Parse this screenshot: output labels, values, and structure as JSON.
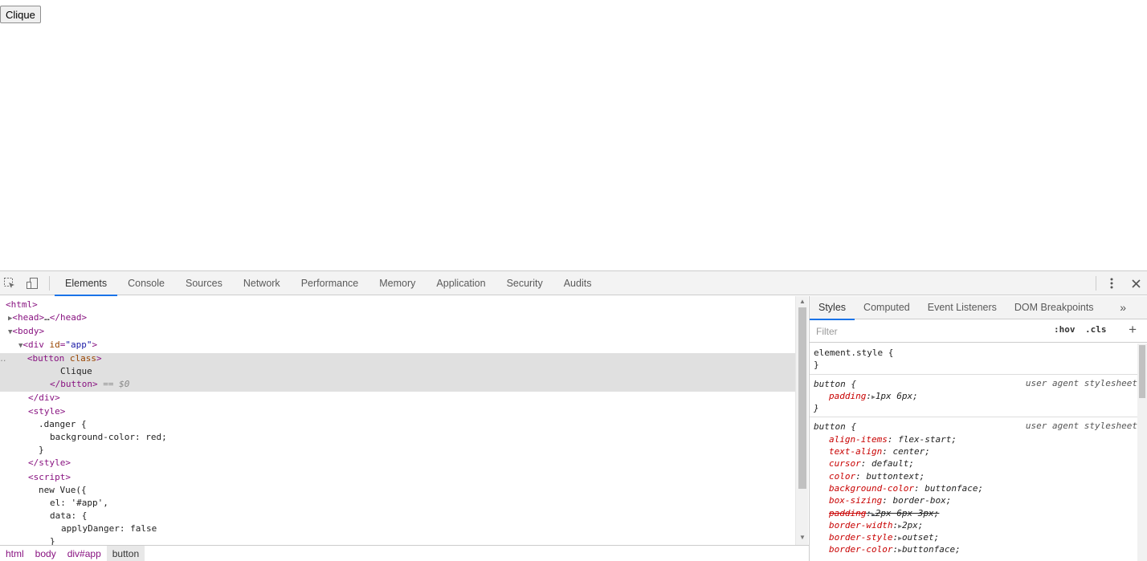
{
  "page": {
    "button_label": "Clique"
  },
  "devtools": {
    "tabs": [
      "Elements",
      "Console",
      "Sources",
      "Network",
      "Performance",
      "Memory",
      "Application",
      "Security",
      "Audits"
    ],
    "active_tab": "Elements",
    "icons": {
      "inspect": "inspect-element-icon",
      "device": "device-toolbar-icon",
      "menu": "more-vertical-icon",
      "close": "close-icon"
    },
    "dom": {
      "html_open": "<html>",
      "head_open": "<head>",
      "head_ellipsis": "…",
      "head_close": "</head>",
      "body_open": "<body>",
      "div_tag": "div",
      "div_attr": "id",
      "div_attr_val": "\"app\"",
      "button_tag": "button",
      "button_attr": "class",
      "button_text": "Clique",
      "button_close": "</button>",
      "selected_marker": "== $0",
      "div_close": "</div>",
      "style_open": "<style>",
      "css_selector": ".danger {",
      "css_decl": "background-color: red;",
      "css_close": "}",
      "style_close": "</style>",
      "script_open": "<script>",
      "js_line1": "new Vue({",
      "js_line2": "el: '#app',",
      "js_line3": "data: {",
      "js_line4": "applyDanger: false",
      "js_line5": "}"
    },
    "breadcrumbs": [
      "html",
      "body",
      "div#app",
      "button"
    ],
    "sidebar": {
      "tabs": [
        "Styles",
        "Computed",
        "Event Listeners",
        "DOM Breakpoints"
      ],
      "active_tab": "Styles",
      "more_label": "»",
      "filter_placeholder": "Filter",
      "hov_label": ":hov",
      "cls_label": ".cls",
      "add_label": "+",
      "rules": [
        {
          "selector": "element.style {",
          "origin": "",
          "close": "}",
          "properties": []
        },
        {
          "selector": "button {",
          "origin": "user agent stylesheet",
          "close": "}",
          "properties": [
            {
              "name": "padding",
              "value": "1px 6px;",
              "expandable": true,
              "overridden": false
            }
          ]
        },
        {
          "selector": "button {",
          "origin": "user agent stylesheet",
          "close": "",
          "properties": [
            {
              "name": "align-items",
              "value": "flex-start;",
              "expandable": false,
              "overridden": false
            },
            {
              "name": "text-align",
              "value": "center;",
              "expandable": false,
              "overridden": false
            },
            {
              "name": "cursor",
              "value": "default;",
              "expandable": false,
              "overridden": false
            },
            {
              "name": "color",
              "value": "buttontext;",
              "expandable": false,
              "overridden": false
            },
            {
              "name": "background-color",
              "value": "buttonface;",
              "expandable": false,
              "overridden": false
            },
            {
              "name": "box-sizing",
              "value": "border-box;",
              "expandable": false,
              "overridden": false
            },
            {
              "name": "padding",
              "value": "2px 6px 3px;",
              "expandable": true,
              "overridden": true
            },
            {
              "name": "border-width",
              "value": "2px;",
              "expandable": true,
              "overridden": false
            },
            {
              "name": "border-style",
              "value": "outset;",
              "expandable": true,
              "overridden": false
            },
            {
              "name": "border-color",
              "value": "buttonface;",
              "expandable": true,
              "overridden": false
            }
          ]
        }
      ]
    }
  },
  "colors": {
    "tag": "#881280",
    "attr_name": "#994500",
    "attr_value": "#1a1aa6",
    "css_prop": "#c80000",
    "active_tab_underline": "#1a73e8",
    "selected_row": "#e0e0e0"
  }
}
